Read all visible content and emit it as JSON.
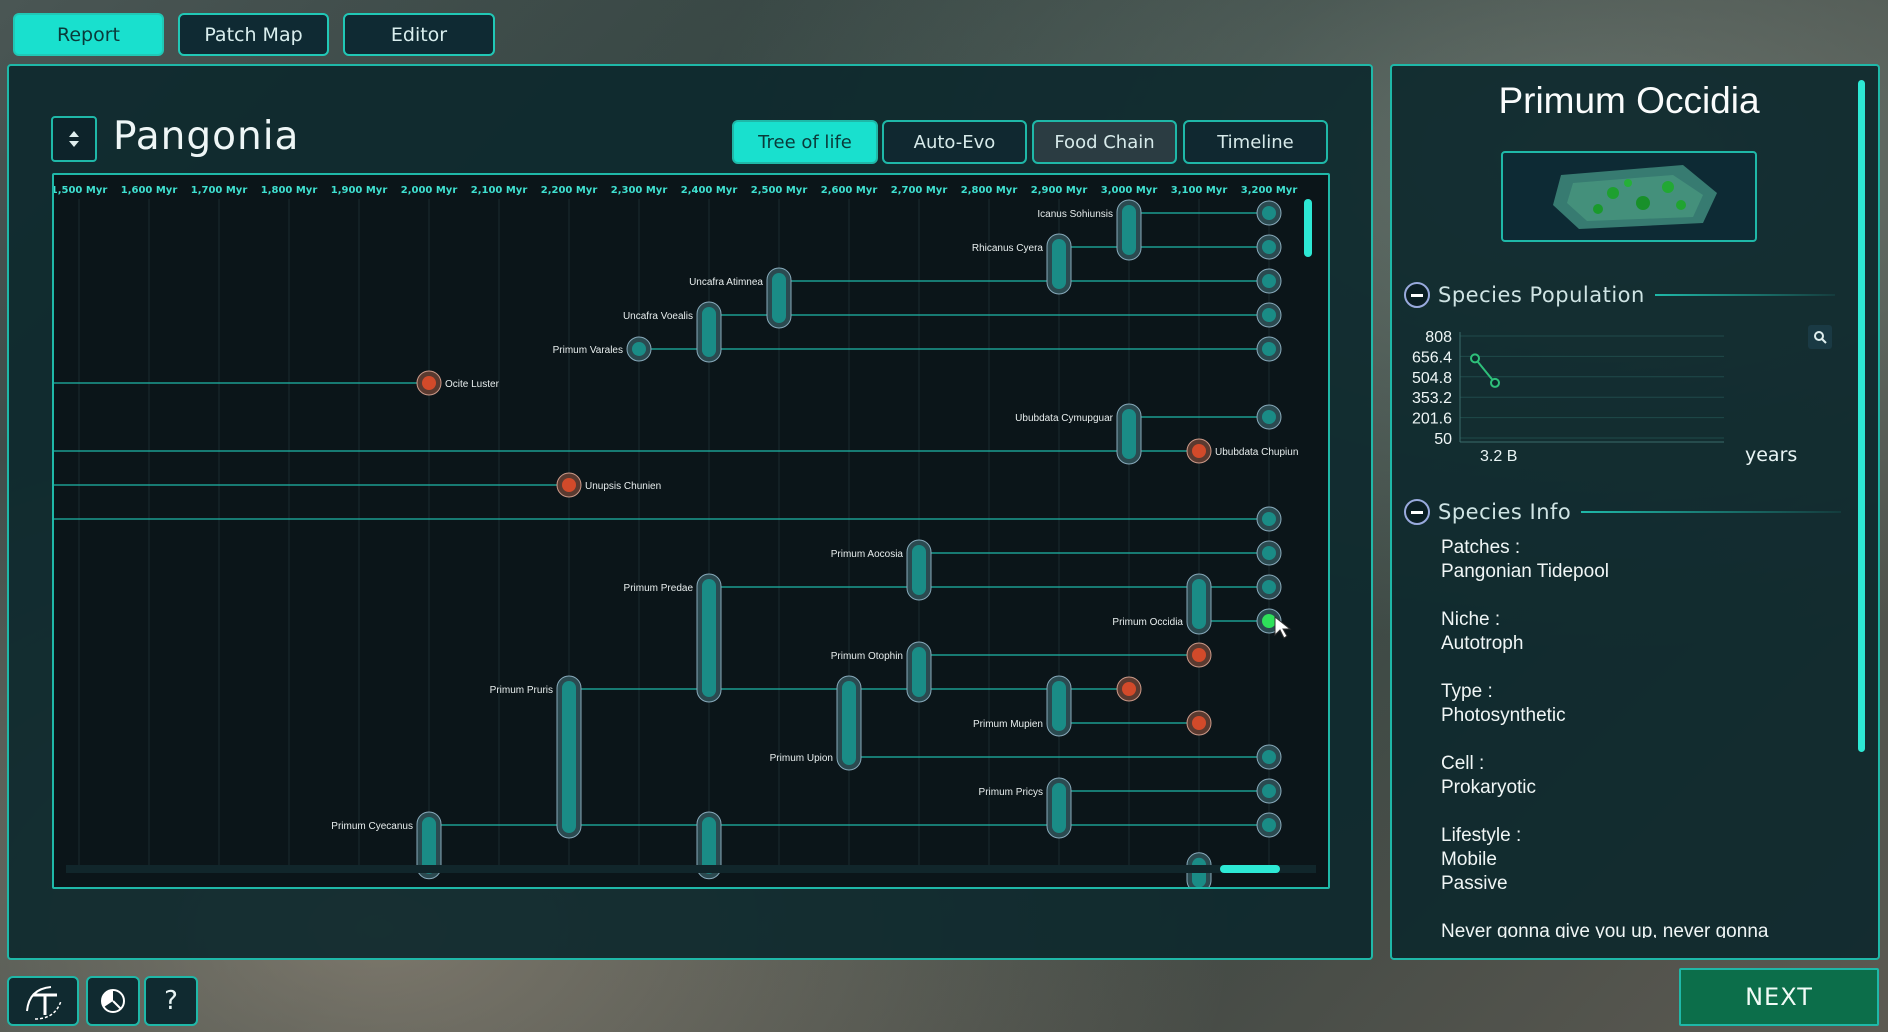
{
  "top_tabs": {
    "report": "Report",
    "patch_map": "Patch Map",
    "editor": "Editor"
  },
  "left": {
    "title": "Pangonia",
    "subtabs": {
      "tree_of_life": "Tree of life",
      "auto_evo": "Auto-Evo",
      "food_chain": "Food Chain",
      "timeline": "Timeline"
    },
    "time_axis": [
      "1,500 Myr",
      "1,600 Myr",
      "1,700 Myr",
      "1,800 Myr",
      "1,900 Myr",
      "2,000 Myr",
      "2,100 Myr",
      "2,200 Myr",
      "2,300 Myr",
      "2,400 Myr",
      "2,500 Myr",
      "2,600 Myr",
      "2,700 Myr",
      "2,800 Myr",
      "2,900 Myr",
      "3,000 Myr",
      "3,100 Myr",
      "3,200 Myr"
    ],
    "species_labels": [
      {
        "name": "Icanus Sohiunsis",
        "t": 3000,
        "row": 0
      },
      {
        "name": "Rhicanus Cyera",
        "t": 2900,
        "row": 1
      },
      {
        "name": "Uncafra Atimnea",
        "t": 2500,
        "row": 2
      },
      {
        "name": "Uncafra Voealis",
        "t": 2400,
        "row": 3
      },
      {
        "name": "Primum Varales",
        "t": 2300,
        "row": 4
      },
      {
        "name": "Ububdata Cymupguar",
        "t": 3000,
        "row": 6
      },
      {
        "name": "Primum Aocosia",
        "t": 2700,
        "row": 10
      },
      {
        "name": "Primum Predae",
        "t": 2400,
        "row": 11
      },
      {
        "name": "Primum Occidia",
        "t": 3100,
        "row": 12
      },
      {
        "name": "Primum Otophin",
        "t": 2700,
        "row": 13
      },
      {
        "name": "Primum Pruris",
        "t": 2200,
        "row": 14
      },
      {
        "name": "Primum Mupien",
        "t": 2900,
        "row": 15
      },
      {
        "name": "Primum Upion",
        "t": 2600,
        "row": 16
      },
      {
        "name": "Primum Pricys",
        "t": 2900,
        "row": 17
      },
      {
        "name": "Primum Cyecanus",
        "t": 2000,
        "row": 18
      }
    ],
    "extinct_labels": [
      {
        "name": "Ocite Luster",
        "t": 2000,
        "row": 5
      },
      {
        "name": "Ububdata Chupiun",
        "t": 3100,
        "row": 7
      },
      {
        "name": "Unupsis Chunien",
        "t": 2200,
        "row": 8
      }
    ]
  },
  "right": {
    "species_name": "Primum Occidia",
    "population": {
      "title": "Species Population",
      "y_ticks": [
        "808",
        "656.4",
        "504.8",
        "353.2",
        "201.6",
        "50"
      ],
      "x_label": "3.2 B",
      "unit_label": "years"
    },
    "info": {
      "title": "Species Info",
      "patches_label": "Patches :",
      "patches_value": "Pangonian Tidepool",
      "niche_label": "Niche :",
      "niche_value": "Autotroph",
      "type_label": "Type :",
      "type_value": "Photosynthetic",
      "cell_label": "Cell :",
      "cell_value": "Prokaryotic",
      "lifestyle_label": "Lifestyle :",
      "lifestyle_value1": "Mobile",
      "lifestyle_value2": "Passive",
      "description": "Never gonna give you up, never gonna"
    }
  },
  "bottom": {
    "help": "?",
    "next": "NEXT"
  },
  "colors": {
    "accent": "#1fb8a8",
    "node": "#1a8c86",
    "extinct": "#d24a2a",
    "selected": "#2ee05a"
  }
}
